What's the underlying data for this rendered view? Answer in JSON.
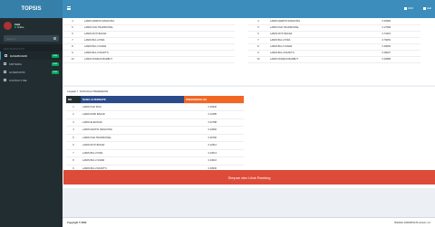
{
  "app": {
    "brand": "TOPSIS"
  },
  "user": {
    "name": "Zaid",
    "status": "Online"
  },
  "search": {
    "placeholder": "Search..."
  },
  "nav": {
    "header": "MAIN NAVIGATION",
    "items": [
      {
        "label": "DASHBOARD",
        "badge": "new",
        "badge_color": "#00a65a",
        "active": true
      },
      {
        "label": "KRITERIA",
        "badge": "new",
        "badge_color": "#00a65a",
        "active": false
      },
      {
        "label": "ALTERNATIF",
        "badge": "new",
        "badge_color": "#00a65a",
        "active": false
      },
      {
        "label": "CONTACT ME",
        "badge": "",
        "badge_color": "",
        "active": false
      }
    ]
  },
  "topbar": {
    "date": "2022",
    "user": "Zaid"
  },
  "top_table_left": [
    [
      "4",
      "LAMIN KEMPIN SINGKONG",
      ""
    ],
    [
      "5",
      "LAMIN KUE TRADISIONAL",
      ""
    ],
    [
      "6",
      "LAMIN ROTI BAKAR",
      ""
    ],
    [
      "7",
      "LAMIN BULU PIRA",
      ""
    ],
    [
      "8",
      "LAMIN BULU SINAR",
      ""
    ],
    [
      "9",
      "LAMIN BULU MUNIT'S",
      ""
    ],
    [
      "10",
      "LAMIN PASIRAS BARBUT",
      ""
    ]
  ],
  "top_table_right": [
    [
      "4",
      "LAMIN KEMPIN SINGKONG",
      "0.26983"
    ],
    [
      "5",
      "LAMIN KUE TRADISIONAL",
      "0.17668"
    ],
    [
      "6",
      "LAMIN ROTI BAKAR",
      "0.73415"
    ],
    [
      "7",
      "LAMIN BULU PIRA",
      "0.79053"
    ],
    [
      "8",
      "LAMIN BULU SINAR",
      "0.28065"
    ],
    [
      "9",
      "LAMIN BULU MUNIT'S",
      "0.08097"
    ],
    [
      "10",
      "LAMIN PASIRAS BARBUT",
      "0.00858"
    ]
  ],
  "main_label": "Langkah 7 : DATA NILAI PREFERENSI",
  "main_table": {
    "headers": {
      "no": "NO.",
      "nama": "NAMA ALTERNATIF",
      "pref": "PREFERENSI (Vi)"
    },
    "rows": [
      [
        "1",
        "LAMIN KUE ISSO",
        "0.35336"
      ],
      [
        "2",
        "LAMIN RORI BAKAR",
        "0.12285"
      ],
      [
        "3",
        "LAMIN ELEGISAR",
        "0.22788"
      ],
      [
        "4",
        "LAMIN KENTIN SINGKONG",
        "0.22666"
      ],
      [
        "5",
        "LAMIN KUE TRADISIONAL",
        "0.39790"
      ],
      [
        "6",
        "LAMIN ROTI BAKAR",
        "0.12512"
      ],
      [
        "7",
        "LAMIN BULU PIRA",
        "0.23013"
      ],
      [
        "8",
        "LAMIN BULU SINAR",
        "0.43016"
      ],
      [
        "9",
        "LAMIN BULU MUNIT'S",
        "0.30536"
      ],
      [
        "10",
        "LAMIN PASIRAS BARBUT",
        "0.17700"
      ]
    ]
  },
  "button": {
    "label": "Simpan dan Lihat Ranking"
  },
  "footer": {
    "left": "Copyright © 2022",
    "right": "BIDANG PARIWISATA Version 1.0"
  }
}
